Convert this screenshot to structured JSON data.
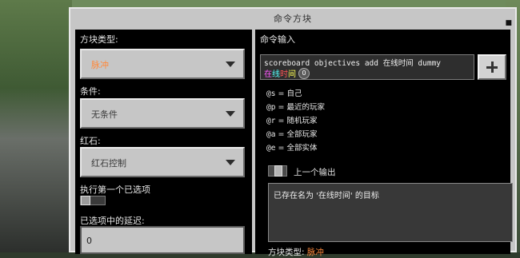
{
  "title": "命令方块",
  "left": {
    "block_type_label": "方块类型:",
    "block_type_value": "脉冲",
    "condition_label": "条件:",
    "condition_value": "无条件",
    "redstone_label": "红石:",
    "redstone_value": "红石控制",
    "execute_first_label": "执行第一个已选项",
    "execute_first_toggle": false,
    "delay_label": "已选项中的延迟:",
    "delay_value": "0"
  },
  "right": {
    "command_input_label": "命令输入",
    "command_text": "scoreboard objectives add 在线时间 dummy",
    "hint_text_chars": [
      "在",
      "线",
      "时",
      "间"
    ],
    "hint_badge": "0",
    "selectors": [
      {
        "code": "@s",
        "desc": "自己"
      },
      {
        "code": "@p",
        "desc": "最近的玩家"
      },
      {
        "code": "@r",
        "desc": "随机玩家"
      },
      {
        "code": "@a",
        "desc": "全部玩家"
      },
      {
        "code": "@e",
        "desc": "全部实体"
      }
    ],
    "previous_output_label": "上一个输出",
    "previous_output_toggle": false,
    "output_text": "已存在名为 '在线时间' 的目标",
    "footer_block_type_label": "方块类型:",
    "footer_block_type_value": "脉冲"
  },
  "colors": {
    "pulse_orange": "#ff8a3d",
    "hint_colors": [
      "#ff5aff",
      "#55ffff",
      "#ff5555",
      "#ffff55"
    ]
  }
}
